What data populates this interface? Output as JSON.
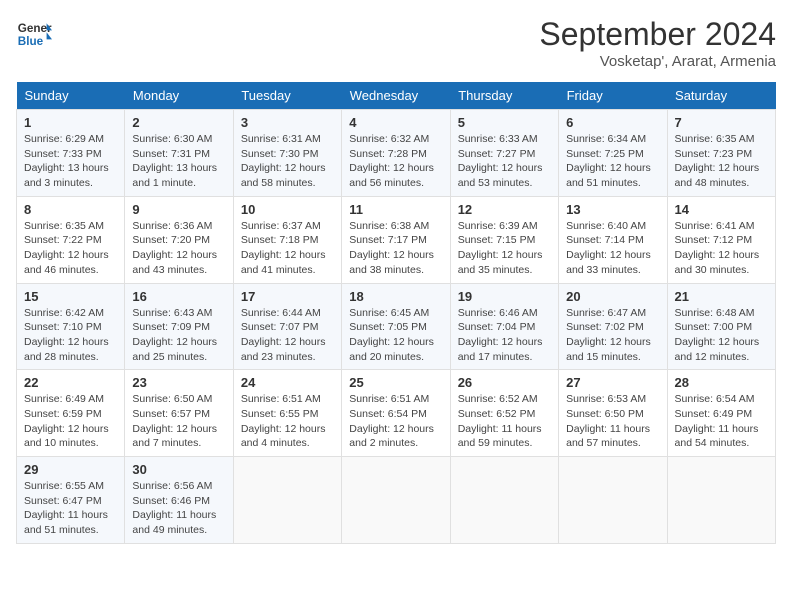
{
  "header": {
    "logo_line1": "General",
    "logo_line2": "Blue",
    "month_year": "September 2024",
    "location": "Vosketap', Ararat, Armenia"
  },
  "days_of_week": [
    "Sunday",
    "Monday",
    "Tuesday",
    "Wednesday",
    "Thursday",
    "Friday",
    "Saturday"
  ],
  "weeks": [
    [
      {
        "day": "1",
        "sunrise": "6:29 AM",
        "sunset": "7:33 PM",
        "daylight": "13 hours and 3 minutes."
      },
      {
        "day": "2",
        "sunrise": "6:30 AM",
        "sunset": "7:31 PM",
        "daylight": "13 hours and 1 minute."
      },
      {
        "day": "3",
        "sunrise": "6:31 AM",
        "sunset": "7:30 PM",
        "daylight": "12 hours and 58 minutes."
      },
      {
        "day": "4",
        "sunrise": "6:32 AM",
        "sunset": "7:28 PM",
        "daylight": "12 hours and 56 minutes."
      },
      {
        "day": "5",
        "sunrise": "6:33 AM",
        "sunset": "7:27 PM",
        "daylight": "12 hours and 53 minutes."
      },
      {
        "day": "6",
        "sunrise": "6:34 AM",
        "sunset": "7:25 PM",
        "daylight": "12 hours and 51 minutes."
      },
      {
        "day": "7",
        "sunrise": "6:35 AM",
        "sunset": "7:23 PM",
        "daylight": "12 hours and 48 minutes."
      }
    ],
    [
      {
        "day": "8",
        "sunrise": "6:35 AM",
        "sunset": "7:22 PM",
        "daylight": "12 hours and 46 minutes."
      },
      {
        "day": "9",
        "sunrise": "6:36 AM",
        "sunset": "7:20 PM",
        "daylight": "12 hours and 43 minutes."
      },
      {
        "day": "10",
        "sunrise": "6:37 AM",
        "sunset": "7:18 PM",
        "daylight": "12 hours and 41 minutes."
      },
      {
        "day": "11",
        "sunrise": "6:38 AM",
        "sunset": "7:17 PM",
        "daylight": "12 hours and 38 minutes."
      },
      {
        "day": "12",
        "sunrise": "6:39 AM",
        "sunset": "7:15 PM",
        "daylight": "12 hours and 35 minutes."
      },
      {
        "day": "13",
        "sunrise": "6:40 AM",
        "sunset": "7:14 PM",
        "daylight": "12 hours and 33 minutes."
      },
      {
        "day": "14",
        "sunrise": "6:41 AM",
        "sunset": "7:12 PM",
        "daylight": "12 hours and 30 minutes."
      }
    ],
    [
      {
        "day": "15",
        "sunrise": "6:42 AM",
        "sunset": "7:10 PM",
        "daylight": "12 hours and 28 minutes."
      },
      {
        "day": "16",
        "sunrise": "6:43 AM",
        "sunset": "7:09 PM",
        "daylight": "12 hours and 25 minutes."
      },
      {
        "day": "17",
        "sunrise": "6:44 AM",
        "sunset": "7:07 PM",
        "daylight": "12 hours and 23 minutes."
      },
      {
        "day": "18",
        "sunrise": "6:45 AM",
        "sunset": "7:05 PM",
        "daylight": "12 hours and 20 minutes."
      },
      {
        "day": "19",
        "sunrise": "6:46 AM",
        "sunset": "7:04 PM",
        "daylight": "12 hours and 17 minutes."
      },
      {
        "day": "20",
        "sunrise": "6:47 AM",
        "sunset": "7:02 PM",
        "daylight": "12 hours and 15 minutes."
      },
      {
        "day": "21",
        "sunrise": "6:48 AM",
        "sunset": "7:00 PM",
        "daylight": "12 hours and 12 minutes."
      }
    ],
    [
      {
        "day": "22",
        "sunrise": "6:49 AM",
        "sunset": "6:59 PM",
        "daylight": "12 hours and 10 minutes."
      },
      {
        "day": "23",
        "sunrise": "6:50 AM",
        "sunset": "6:57 PM",
        "daylight": "12 hours and 7 minutes."
      },
      {
        "day": "24",
        "sunrise": "6:51 AM",
        "sunset": "6:55 PM",
        "daylight": "12 hours and 4 minutes."
      },
      {
        "day": "25",
        "sunrise": "6:51 AM",
        "sunset": "6:54 PM",
        "daylight": "12 hours and 2 minutes."
      },
      {
        "day": "26",
        "sunrise": "6:52 AM",
        "sunset": "6:52 PM",
        "daylight": "11 hours and 59 minutes."
      },
      {
        "day": "27",
        "sunrise": "6:53 AM",
        "sunset": "6:50 PM",
        "daylight": "11 hours and 57 minutes."
      },
      {
        "day": "28",
        "sunrise": "6:54 AM",
        "sunset": "6:49 PM",
        "daylight": "11 hours and 54 minutes."
      }
    ],
    [
      {
        "day": "29",
        "sunrise": "6:55 AM",
        "sunset": "6:47 PM",
        "daylight": "11 hours and 51 minutes."
      },
      {
        "day": "30",
        "sunrise": "6:56 AM",
        "sunset": "6:46 PM",
        "daylight": "11 hours and 49 minutes."
      },
      null,
      null,
      null,
      null,
      null
    ]
  ]
}
